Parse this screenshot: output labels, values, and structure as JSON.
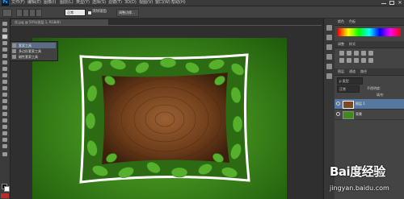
{
  "app": {
    "logo_text": "Ps"
  },
  "menubar": {
    "items": [
      "文件(F)",
      "编辑(E)",
      "图像(I)",
      "图层(L)",
      "类型(Y)",
      "选择(S)",
      "滤镜(T)",
      "3D(D)",
      "视图(V)",
      "窗口(W)",
      "帮助(H)"
    ]
  },
  "options": {
    "mode_label": "正常",
    "antialias_label": "消除锯齿",
    "refine_button": "调整边缘..."
  },
  "document": {
    "tab_title": "花.jpg @ 50%(图层 1, RGB/8)"
  },
  "flyout": {
    "items": [
      {
        "label": "套索工具"
      },
      {
        "label": "多边形套索工具"
      },
      {
        "label": "磁性套索工具"
      }
    ]
  },
  "panels": {
    "top_tabs": [
      "颜色",
      "色板"
    ],
    "adjust_tabs": [
      "调整",
      "样式"
    ],
    "layer_tabs": [
      "图层",
      "通道",
      "路径"
    ],
    "layers_search": "p 类型",
    "blend_mode": "正常",
    "opacity_label": "不透明度:",
    "fill_label": "填充:",
    "layers": [
      {
        "name": "图层 1"
      },
      {
        "name": "背景"
      }
    ]
  },
  "watermark": {
    "logo": "Bai度经验",
    "url": "jingyan.baidu.com"
  },
  "colors": {
    "bg": "#2d2d2d",
    "panel": "#444444",
    "accent": "#5577a0",
    "leaf": "#4fa22a",
    "wood": "#7a4a24"
  }
}
